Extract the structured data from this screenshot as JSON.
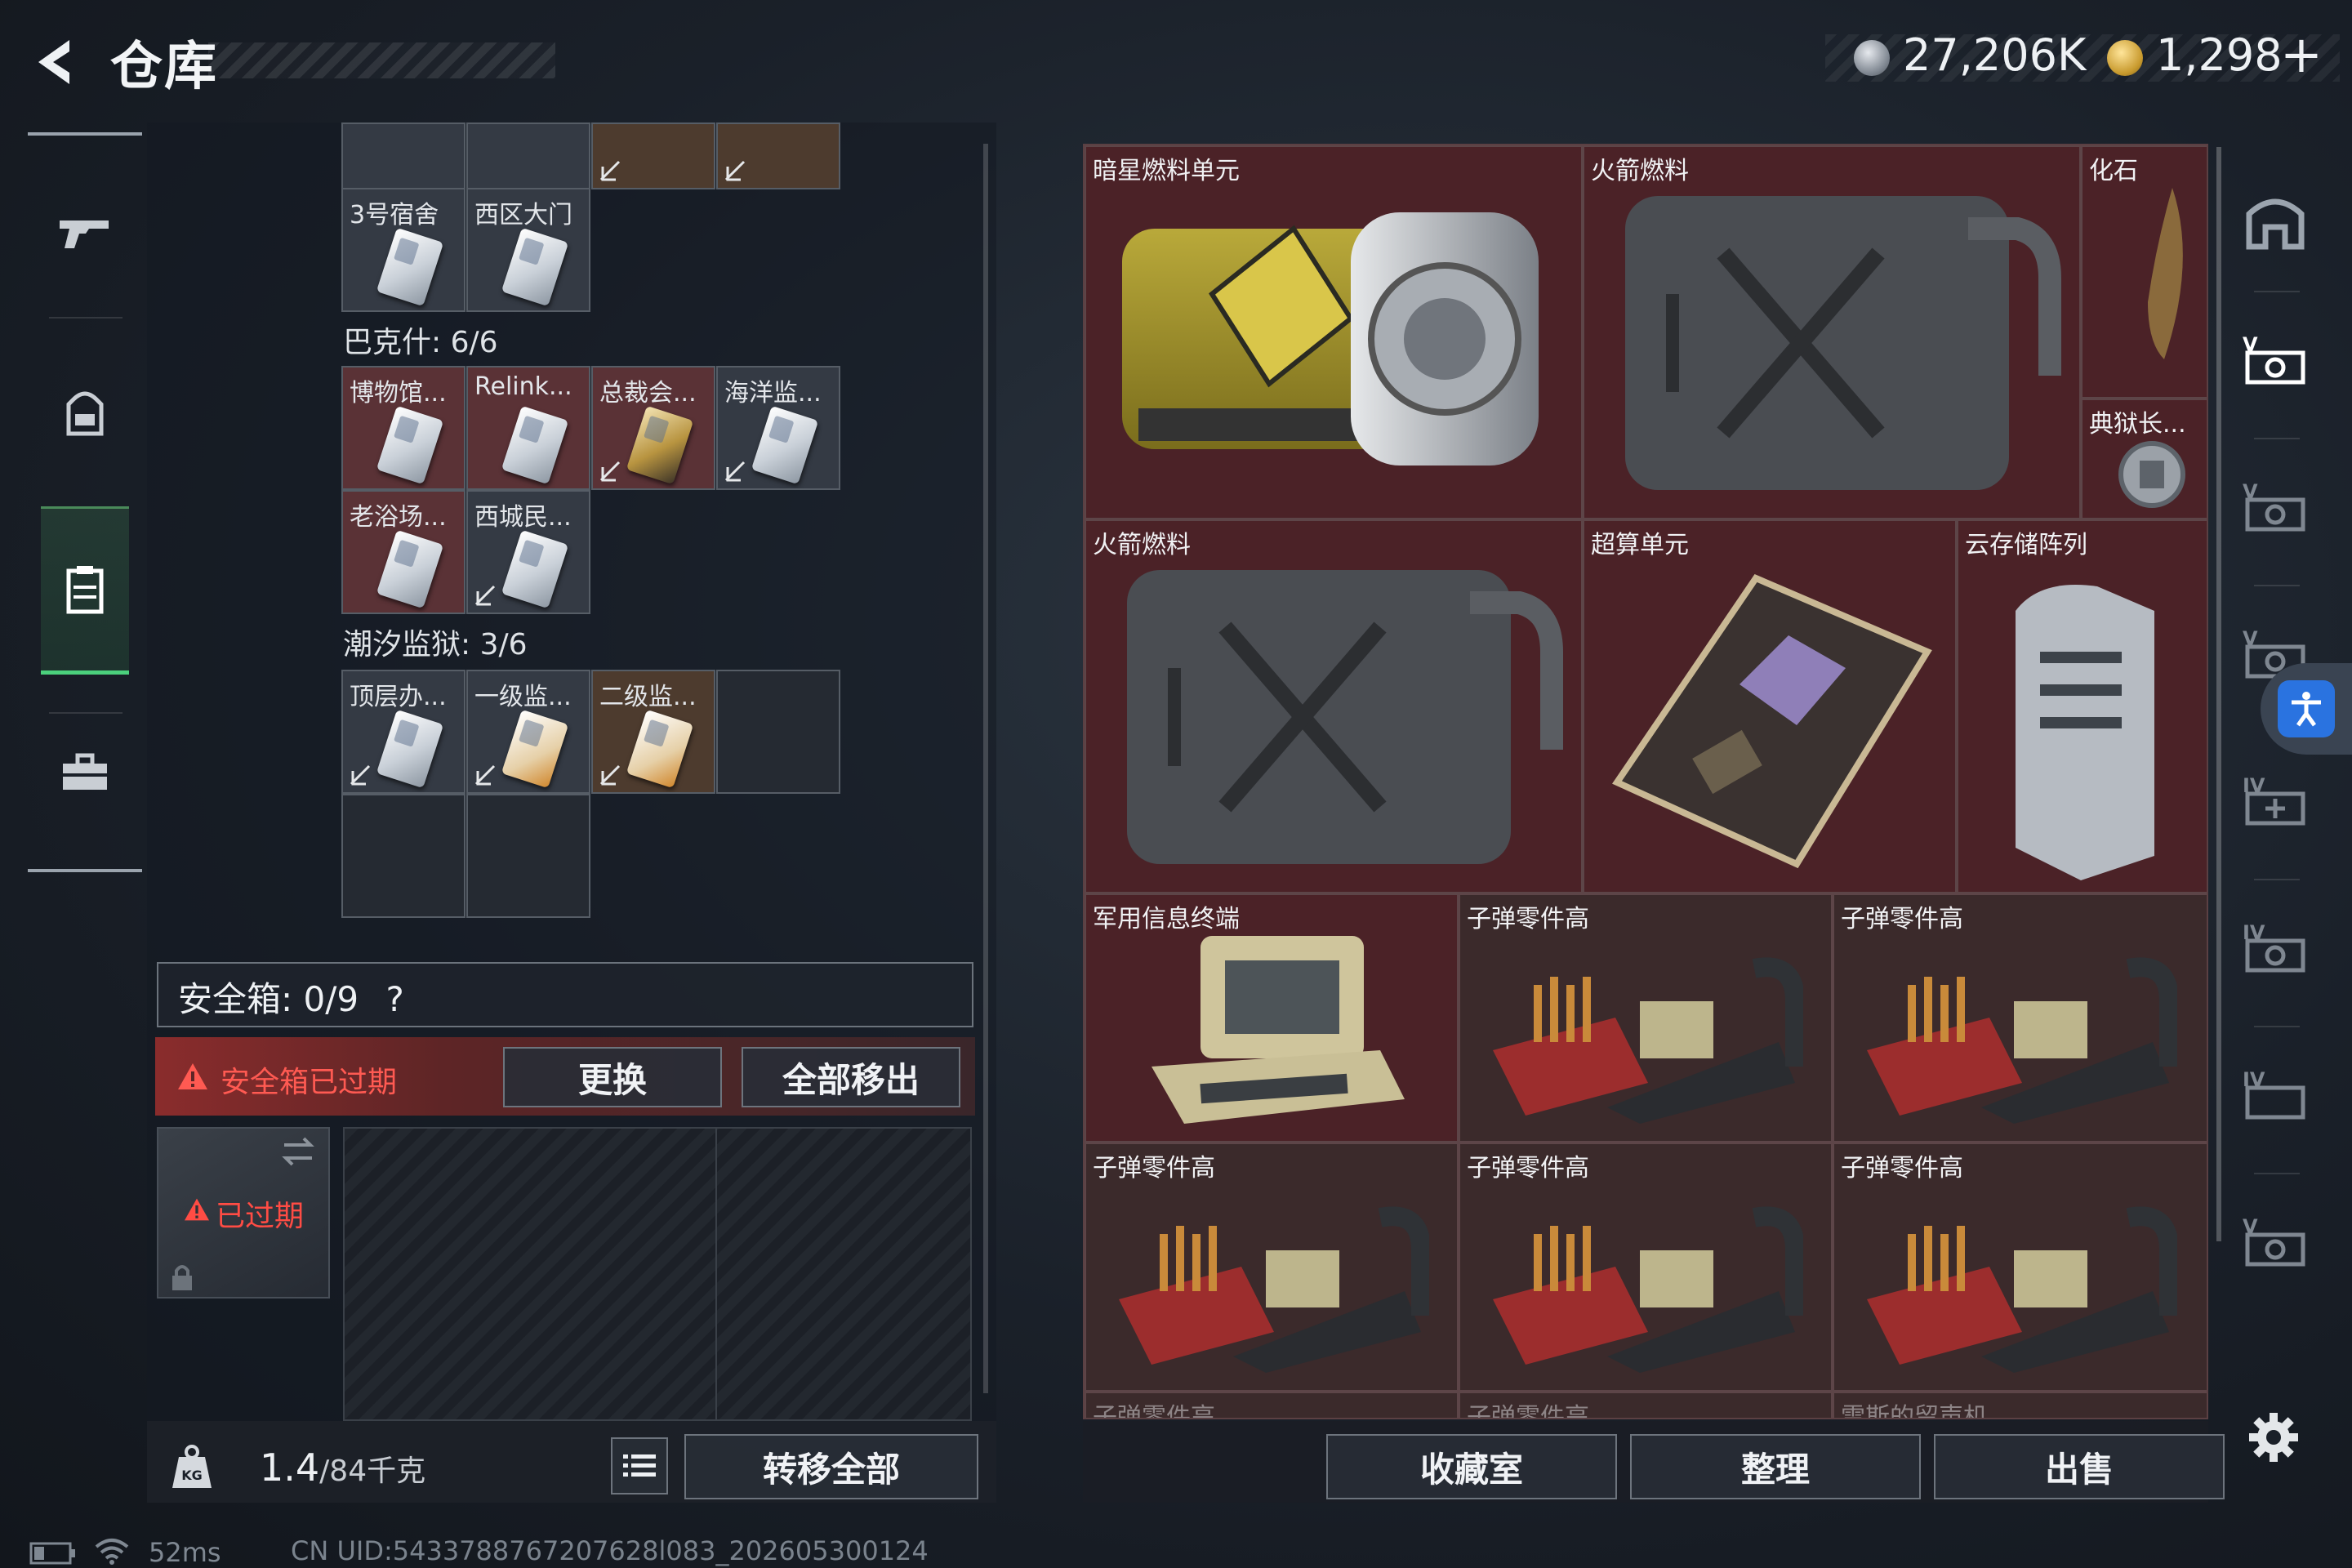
{
  "header": {
    "title": "仓库",
    "currency1_value": "27,206K",
    "currency2_value": "1,298",
    "currency2_plus": "+"
  },
  "nav": {
    "items": [
      "weapon",
      "backpack",
      "storage",
      "toolbox"
    ],
    "active": "storage"
  },
  "left": {
    "top_slot_labels": [
      "3号宿舍",
      "西区大门"
    ],
    "group_bakesh": "巴克什: 6/6",
    "bakesh_slots": [
      "博物馆...",
      "Relink...",
      "总裁会...",
      "海洋监...",
      "老浴场...",
      "西城民..."
    ],
    "group_tide": "潮汐监狱: 3/6",
    "tide_slots": [
      "顶层办...",
      "一级监...",
      "二级监..."
    ],
    "safebox_label": "安全箱: 0/9",
    "safebox_help": "?",
    "expired_text": "安全箱已过期",
    "replace_button": "更换",
    "remove_all_button": "全部移出",
    "case_expired": "已过期",
    "weight_current": "1.4",
    "weight_total": "/84千克",
    "transfer_all_button": "转移全部"
  },
  "warehouse": {
    "items": [
      {
        "name": "暗星燃料单元"
      },
      {
        "name": "火箭燃料"
      },
      {
        "name": "化石"
      },
      {
        "name": "典狱长..."
      },
      {
        "name": "火箭燃料"
      },
      {
        "name": "超算单元"
      },
      {
        "name": "云存储阵列"
      },
      {
        "name": "军用信息终端"
      },
      {
        "name": "子弹零件高"
      },
      {
        "name": "子弹零件高"
      },
      {
        "name": "子弹零件高"
      },
      {
        "name": "子弹零件高"
      },
      {
        "name": "子弹零件高"
      },
      {
        "name": "子弹零件高"
      },
      {
        "name": "子弹零件高"
      },
      {
        "name": "雷斯的留声机"
      }
    ],
    "buttons": {
      "collection": "收藏室",
      "sort": "整理",
      "sell": "出售"
    },
    "side_tabs": [
      "home",
      "V",
      "V",
      "V",
      "IV",
      "IV",
      "IV",
      "V"
    ]
  },
  "status": {
    "ping": "52ms",
    "uid": "CN UID:5433788767207628l083_202605300124"
  },
  "colors": {
    "accent_green": "#4bd07c",
    "warn_red": "#ff5a52",
    "warehouse_bg": "#3c2024"
  }
}
